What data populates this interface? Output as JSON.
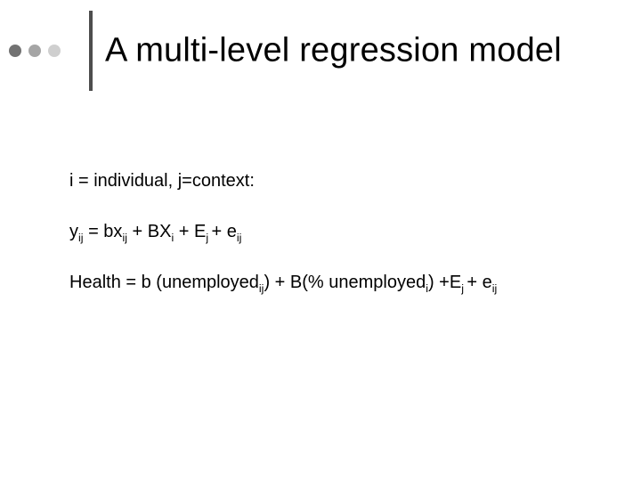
{
  "title": "A multi-level regression model",
  "lines": {
    "l1": "i = individual, j=context:",
    "eq": {
      "a": "y",
      "a_sub": "ij",
      "b": " = bx",
      "b_sub": "ij",
      "c": " + BX",
      "c_sub": "i",
      "d": " + E",
      "d_sub": "j ",
      "e": "+ e",
      "e_sub": "ij"
    },
    "ex": {
      "a": "Health = b (unemployed",
      "a_sub": "ij",
      "b": ") + B(% unemployed",
      "b_sub": "i",
      "c": ") +E",
      "c_sub": "j ",
      "d": "+ e",
      "d_sub": "ij"
    }
  }
}
